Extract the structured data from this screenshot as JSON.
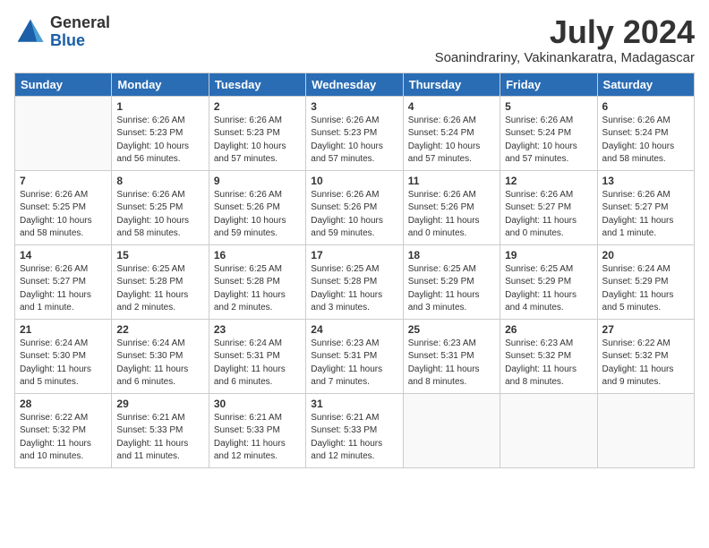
{
  "header": {
    "logo_line1": "General",
    "logo_line2": "Blue",
    "month_year": "July 2024",
    "location": "Soanindrariny, Vakinankaratra, Madagascar"
  },
  "weekdays": [
    "Sunday",
    "Monday",
    "Tuesday",
    "Wednesday",
    "Thursday",
    "Friday",
    "Saturday"
  ],
  "weeks": [
    [
      {
        "day": "",
        "empty": true
      },
      {
        "day": "1",
        "sunrise": "Sunrise: 6:26 AM",
        "sunset": "Sunset: 5:23 PM",
        "daylight": "Daylight: 10 hours and 56 minutes."
      },
      {
        "day": "2",
        "sunrise": "Sunrise: 6:26 AM",
        "sunset": "Sunset: 5:23 PM",
        "daylight": "Daylight: 10 hours and 57 minutes."
      },
      {
        "day": "3",
        "sunrise": "Sunrise: 6:26 AM",
        "sunset": "Sunset: 5:23 PM",
        "daylight": "Daylight: 10 hours and 57 minutes."
      },
      {
        "day": "4",
        "sunrise": "Sunrise: 6:26 AM",
        "sunset": "Sunset: 5:24 PM",
        "daylight": "Daylight: 10 hours and 57 minutes."
      },
      {
        "day": "5",
        "sunrise": "Sunrise: 6:26 AM",
        "sunset": "Sunset: 5:24 PM",
        "daylight": "Daylight: 10 hours and 57 minutes."
      },
      {
        "day": "6",
        "sunrise": "Sunrise: 6:26 AM",
        "sunset": "Sunset: 5:24 PM",
        "daylight": "Daylight: 10 hours and 58 minutes."
      }
    ],
    [
      {
        "day": "7",
        "sunrise": "Sunrise: 6:26 AM",
        "sunset": "Sunset: 5:25 PM",
        "daylight": "Daylight: 10 hours and 58 minutes."
      },
      {
        "day": "8",
        "sunrise": "Sunrise: 6:26 AM",
        "sunset": "Sunset: 5:25 PM",
        "daylight": "Daylight: 10 hours and 58 minutes."
      },
      {
        "day": "9",
        "sunrise": "Sunrise: 6:26 AM",
        "sunset": "Sunset: 5:26 PM",
        "daylight": "Daylight: 10 hours and 59 minutes."
      },
      {
        "day": "10",
        "sunrise": "Sunrise: 6:26 AM",
        "sunset": "Sunset: 5:26 PM",
        "daylight": "Daylight: 10 hours and 59 minutes."
      },
      {
        "day": "11",
        "sunrise": "Sunrise: 6:26 AM",
        "sunset": "Sunset: 5:26 PM",
        "daylight": "Daylight: 11 hours and 0 minutes."
      },
      {
        "day": "12",
        "sunrise": "Sunrise: 6:26 AM",
        "sunset": "Sunset: 5:27 PM",
        "daylight": "Daylight: 11 hours and 0 minutes."
      },
      {
        "day": "13",
        "sunrise": "Sunrise: 6:26 AM",
        "sunset": "Sunset: 5:27 PM",
        "daylight": "Daylight: 11 hours and 1 minute."
      }
    ],
    [
      {
        "day": "14",
        "sunrise": "Sunrise: 6:26 AM",
        "sunset": "Sunset: 5:27 PM",
        "daylight": "Daylight: 11 hours and 1 minute."
      },
      {
        "day": "15",
        "sunrise": "Sunrise: 6:25 AM",
        "sunset": "Sunset: 5:28 PM",
        "daylight": "Daylight: 11 hours and 2 minutes."
      },
      {
        "day": "16",
        "sunrise": "Sunrise: 6:25 AM",
        "sunset": "Sunset: 5:28 PM",
        "daylight": "Daylight: 11 hours and 2 minutes."
      },
      {
        "day": "17",
        "sunrise": "Sunrise: 6:25 AM",
        "sunset": "Sunset: 5:28 PM",
        "daylight": "Daylight: 11 hours and 3 minutes."
      },
      {
        "day": "18",
        "sunrise": "Sunrise: 6:25 AM",
        "sunset": "Sunset: 5:29 PM",
        "daylight": "Daylight: 11 hours and 3 minutes."
      },
      {
        "day": "19",
        "sunrise": "Sunrise: 6:25 AM",
        "sunset": "Sunset: 5:29 PM",
        "daylight": "Daylight: 11 hours and 4 minutes."
      },
      {
        "day": "20",
        "sunrise": "Sunrise: 6:24 AM",
        "sunset": "Sunset: 5:29 PM",
        "daylight": "Daylight: 11 hours and 5 minutes."
      }
    ],
    [
      {
        "day": "21",
        "sunrise": "Sunrise: 6:24 AM",
        "sunset": "Sunset: 5:30 PM",
        "daylight": "Daylight: 11 hours and 5 minutes."
      },
      {
        "day": "22",
        "sunrise": "Sunrise: 6:24 AM",
        "sunset": "Sunset: 5:30 PM",
        "daylight": "Daylight: 11 hours and 6 minutes."
      },
      {
        "day": "23",
        "sunrise": "Sunrise: 6:24 AM",
        "sunset": "Sunset: 5:31 PM",
        "daylight": "Daylight: 11 hours and 6 minutes."
      },
      {
        "day": "24",
        "sunrise": "Sunrise: 6:23 AM",
        "sunset": "Sunset: 5:31 PM",
        "daylight": "Daylight: 11 hours and 7 minutes."
      },
      {
        "day": "25",
        "sunrise": "Sunrise: 6:23 AM",
        "sunset": "Sunset: 5:31 PM",
        "daylight": "Daylight: 11 hours and 8 minutes."
      },
      {
        "day": "26",
        "sunrise": "Sunrise: 6:23 AM",
        "sunset": "Sunset: 5:32 PM",
        "daylight": "Daylight: 11 hours and 8 minutes."
      },
      {
        "day": "27",
        "sunrise": "Sunrise: 6:22 AM",
        "sunset": "Sunset: 5:32 PM",
        "daylight": "Daylight: 11 hours and 9 minutes."
      }
    ],
    [
      {
        "day": "28",
        "sunrise": "Sunrise: 6:22 AM",
        "sunset": "Sunset: 5:32 PM",
        "daylight": "Daylight: 11 hours and 10 minutes."
      },
      {
        "day": "29",
        "sunrise": "Sunrise: 6:21 AM",
        "sunset": "Sunset: 5:33 PM",
        "daylight": "Daylight: 11 hours and 11 minutes."
      },
      {
        "day": "30",
        "sunrise": "Sunrise: 6:21 AM",
        "sunset": "Sunset: 5:33 PM",
        "daylight": "Daylight: 11 hours and 12 minutes."
      },
      {
        "day": "31",
        "sunrise": "Sunrise: 6:21 AM",
        "sunset": "Sunset: 5:33 PM",
        "daylight": "Daylight: 11 hours and 12 minutes."
      },
      {
        "day": "",
        "empty": true
      },
      {
        "day": "",
        "empty": true
      },
      {
        "day": "",
        "empty": true
      }
    ]
  ]
}
